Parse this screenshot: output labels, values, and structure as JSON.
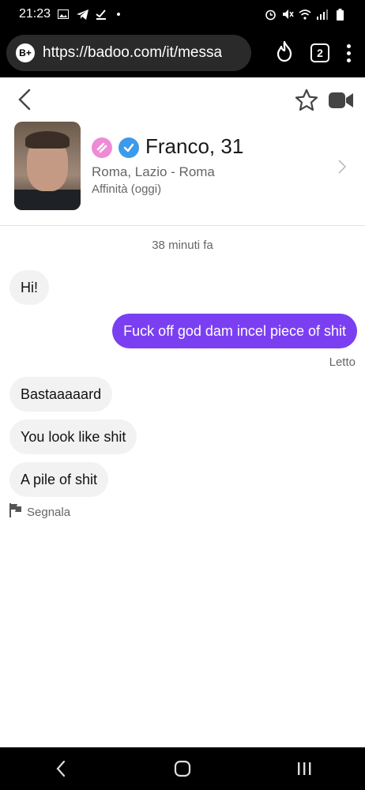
{
  "status_bar": {
    "time": "21:23",
    "left_icons": [
      "gallery-icon",
      "telegram-icon",
      "download-check-icon"
    ],
    "right_icons": [
      "alarm-icon",
      "mute-icon",
      "wifi-icon",
      "signal-icon",
      "battery-icon"
    ]
  },
  "browser": {
    "site_badge": "B+",
    "url": "https://badoo.com/it/messa",
    "tab_count": "2",
    "icons": [
      "fire-icon",
      "tabs-icon",
      "menu-icon"
    ]
  },
  "profile": {
    "name": "Franco, 31",
    "location": "Roma, Lazio - Roma",
    "affinity": "Affinità (oggi)",
    "badge_colors": {
      "pink": "#ee8ad6",
      "verified": "#3d9ae8"
    }
  },
  "chat": {
    "timestamp": "38 minuti fa",
    "messages": [
      {
        "direction": "incoming",
        "text": "Hi!"
      },
      {
        "direction": "outgoing",
        "text": "Fuck off god dam incel piece of shit"
      },
      {
        "direction": "incoming",
        "text": "Bastaaaaard"
      },
      {
        "direction": "incoming",
        "text": "You look like shit"
      },
      {
        "direction": "incoming",
        "text": "A pile of shit"
      }
    ],
    "read_status": "Letto",
    "report_label": "Segnala"
  },
  "colors": {
    "outgoing_bubble": "#7b3ff2",
    "incoming_bubble": "#f2f2f2"
  }
}
